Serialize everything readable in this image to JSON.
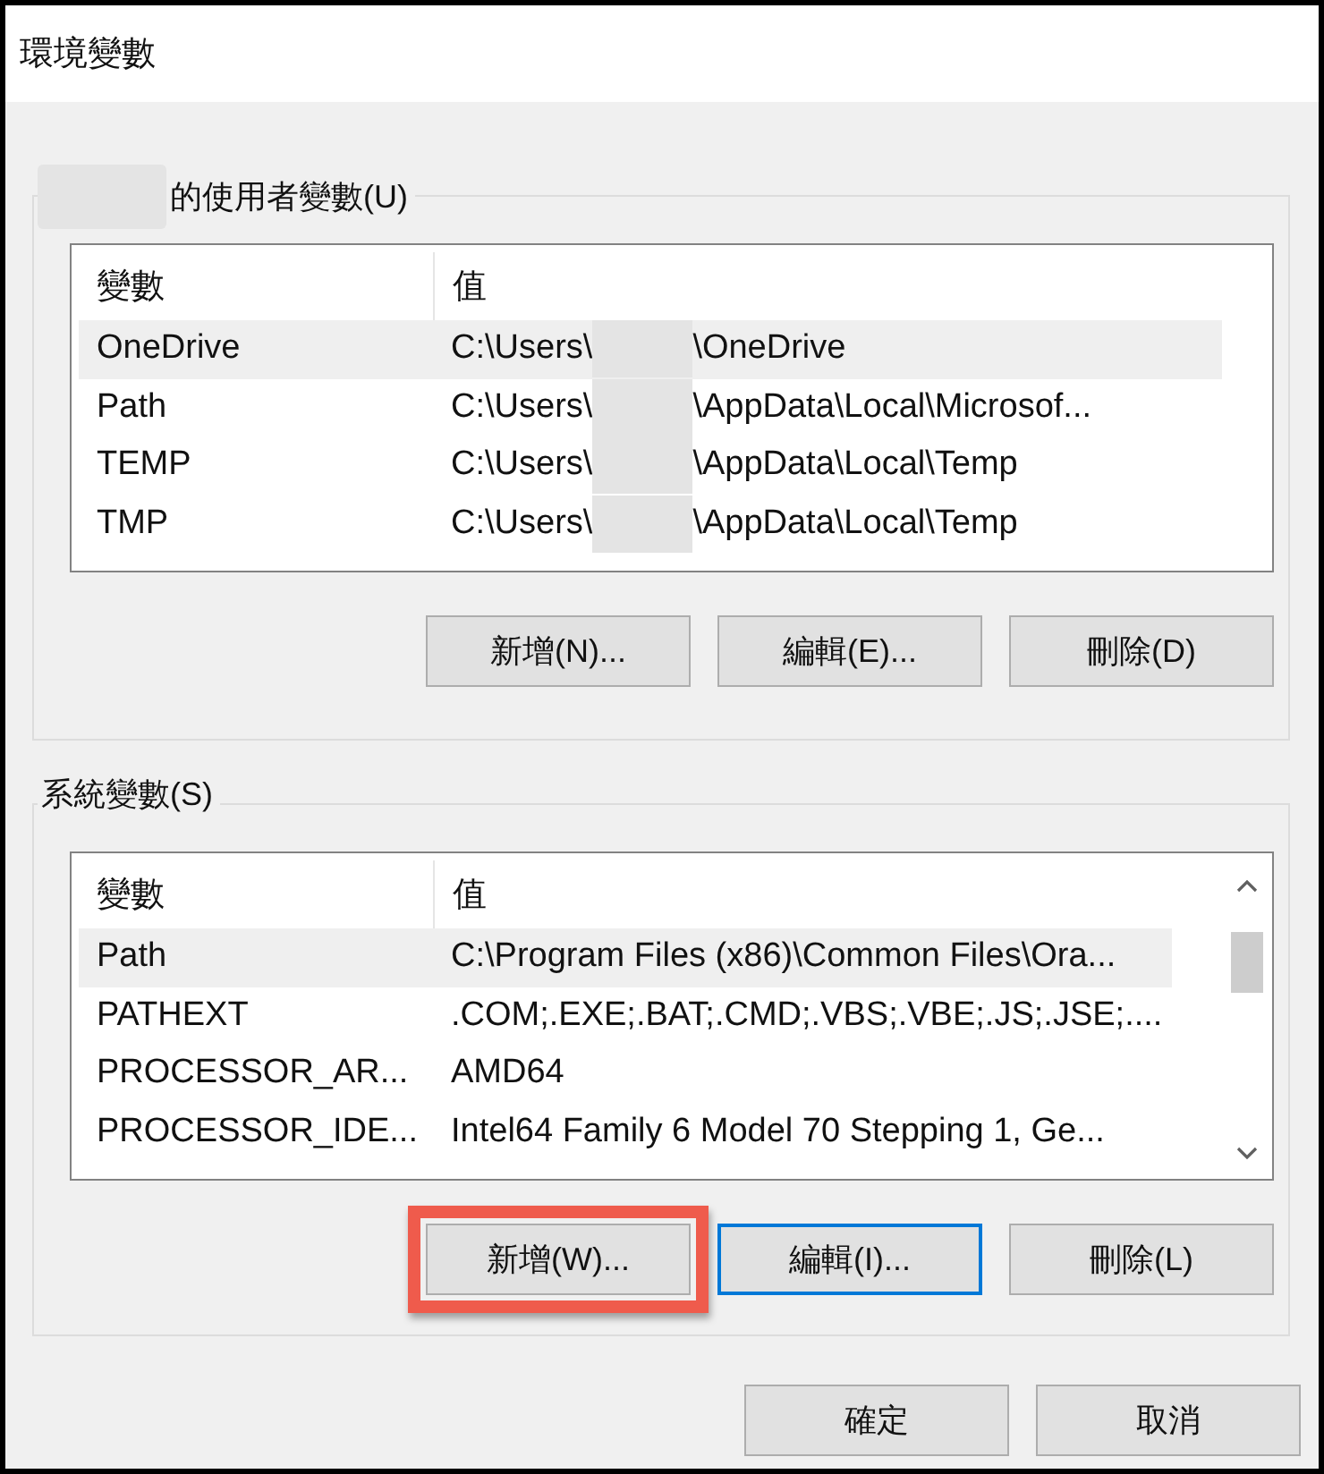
{
  "window": {
    "title": "環境變數"
  },
  "groups": [
    {
      "title": "的使用者變數(U)",
      "title_redacted": true,
      "scrollbar": false,
      "columns": [
        "變數",
        "值"
      ],
      "rows": [
        {
          "name": "OneDrive",
          "value_parts": [
            "C:\\Users\\",
            "\\OneDrive"
          ],
          "selected": true
        },
        {
          "name": "Path",
          "value_parts": [
            "C:\\Users\\",
            "\\AppData\\Local\\Microsof..."
          ],
          "selected": false
        },
        {
          "name": "TEMP",
          "value_parts": [
            "C:\\Users\\",
            "\\AppData\\Local\\Temp"
          ],
          "selected": false
        },
        {
          "name": "TMP",
          "value_parts": [
            "C:\\Users\\",
            "\\AppData\\Local\\Temp"
          ],
          "selected": false
        }
      ],
      "buttons": [
        {
          "label": "新增(N)...",
          "focused": false,
          "highlighted": false
        },
        {
          "label": "編輯(E)...",
          "focused": false,
          "highlighted": false
        },
        {
          "label": "刪除(D)",
          "focused": false,
          "highlighted": false
        }
      ]
    },
    {
      "title": "系統變數(S)",
      "title_redacted": false,
      "scrollbar": true,
      "columns": [
        "變數",
        "值"
      ],
      "rows": [
        {
          "name": "Path",
          "value_parts": [
            "C:\\Program Files (x86)\\Common Files\\Ora..."
          ],
          "selected": true
        },
        {
          "name": "PATHEXT",
          "value_parts": [
            ".COM;.EXE;.BAT;.CMD;.VBS;.VBE;.JS;.JSE;...."
          ],
          "selected": false
        },
        {
          "name": "PROCESSOR_AR...",
          "value_parts": [
            "AMD64"
          ],
          "selected": false
        },
        {
          "name": "PROCESSOR_IDE...",
          "value_parts": [
            "Intel64 Family 6 Model 70 Stepping 1, Ge..."
          ],
          "selected": false
        }
      ],
      "buttons": [
        {
          "label": "新增(W)...",
          "focused": false,
          "highlighted": true
        },
        {
          "label": "編輯(I)...",
          "focused": true,
          "highlighted": false
        },
        {
          "label": "刪除(L)",
          "focused": false,
          "highlighted": false
        }
      ]
    }
  ],
  "footer_buttons": [
    {
      "label": "確定"
    },
    {
      "label": "取消"
    }
  ]
}
